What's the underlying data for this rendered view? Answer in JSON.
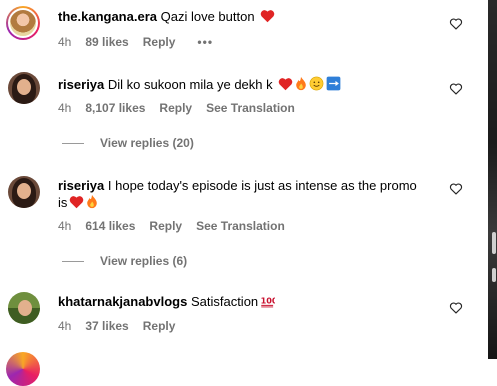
{
  "comments": [
    {
      "username": "the.kangana.era",
      "text": "Qazi love button",
      "emojis": [
        "red-heart"
      ],
      "time": "4h",
      "likes": "89 likes",
      "reply": "Reply",
      "extra": "•••"
    },
    {
      "username": "riseriya",
      "text": "Dil ko sukoon mila ye dekh k",
      "emojis": [
        "red-heart",
        "fire",
        "smiling-face",
        "on-button"
      ],
      "time": "4h",
      "likes": "8,107 likes",
      "reply": "Reply",
      "translation": "See Translation",
      "view_replies": "View replies (20)"
    },
    {
      "username": "riseriya",
      "text_line1": "I hope today's episode is just as intense as the promo",
      "text_line2": "is",
      "emojis": [
        "red-heart",
        "fire"
      ],
      "time": "4h",
      "likes": "614 likes",
      "reply": "Reply",
      "translation": "See Translation",
      "view_replies": "View replies (6)"
    },
    {
      "username": "khatarnakjanabvlogs",
      "text": "Satisfaction",
      "emojis": [
        "hundred-points"
      ],
      "time": "4h",
      "likes": "37 likes",
      "reply": "Reply"
    }
  ],
  "colors": {
    "meta_gray": "#737373",
    "heart_red": "#e02424",
    "fire_orange": "#ff7a1a"
  },
  "icons": {
    "like": "heart-outline-icon"
  }
}
